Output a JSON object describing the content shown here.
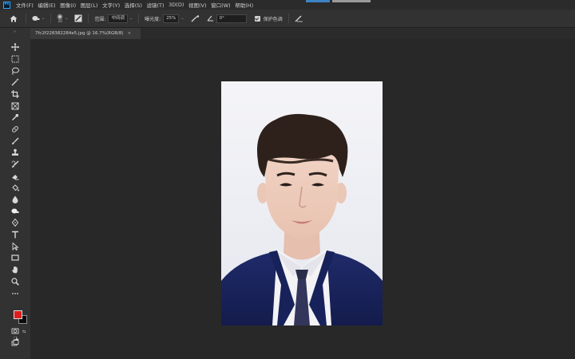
{
  "app": {
    "logo_text": "Ps"
  },
  "menu": [
    "文件(F)",
    "编辑(E)",
    "图像(I)",
    "图层(L)",
    "文字(Y)",
    "选择(S)",
    "滤镜(T)",
    "3D(D)",
    "视图(V)",
    "窗口(W)",
    "帮助(H)"
  ],
  "options": {
    "brush_size": "20",
    "range_label": "范围:",
    "range_value": "中间调",
    "exposure_label": "曝光度:",
    "exposure_value": "25%",
    "angle_value": "0°",
    "protect_tones_label": "保护色调"
  },
  "document": {
    "tab_title": "7fc2f228382284e5.jpg @ 16.7%(RGB/8)",
    "close_glyph": "×"
  },
  "colors": {
    "foreground": "#e01d1d",
    "background": "#0c0c0c",
    "accent": "#31a8ff"
  },
  "icons": {
    "options": [
      "home-icon",
      "dodge-tool-icon",
      "brush-preset-icon",
      "airbrush-icon",
      "angle-icon",
      "pressure-icon"
    ],
    "tools": [
      "move-icon",
      "marquee-icon",
      "lasso-icon",
      "magic-wand-icon",
      "crop-icon",
      "frame-icon",
      "eyedropper-icon",
      "healing-brush-icon",
      "brush-icon",
      "clone-stamp-icon",
      "history-brush-icon",
      "eraser-icon",
      "paint-bucket-icon",
      "blur-icon",
      "dodge-icon",
      "pen-icon",
      "type-icon",
      "path-selection-icon",
      "rectangle-icon",
      "hand-icon",
      "zoom-icon",
      "more-tools-icon",
      "quick-mask-icon",
      "screen-mode-icon"
    ]
  }
}
